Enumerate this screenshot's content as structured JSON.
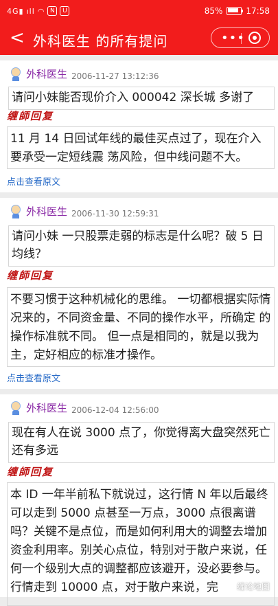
{
  "status_bar": {
    "left_icons": [
      "signal-4g-icon",
      "signal-icon",
      "wifi-icon",
      "app-n-icon",
      "app-u-icon"
    ],
    "battery": "85%",
    "time": "17:58"
  },
  "header": {
    "back_symbol": "<",
    "title": "外科医生  的所有提问"
  },
  "posts": [
    {
      "asker": "外科医生",
      "time": "2006-11-27 13:12:36",
      "question": "请问小妹能否现价介入 000042 深长城 多谢了",
      "reply_label": "缠師回复",
      "reply": "11 月 14 日回试年线的最佳买点过了，现在介入要承受一定短线震 荡风险，但中线问题不大。",
      "link": "点击查看原文"
    },
    {
      "asker": "外科医生",
      "time": "2006-11-30 12:59:31",
      "question": "请问小妹 一只股票走弱的标志是什么呢？破 5 日均线？",
      "reply_label": "缠師回复",
      "reply": "不要习惯于这种机械化的思维。 一切都根据实际情况来的，不同资金量、不同的操作水平，所确定 的操作标准就不同。 但一点是相同的，就是以我为主，定好相应的标准才操作。",
      "link": "点击查看原文"
    },
    {
      "asker": "外科医生",
      "time": "2006-12-04 12:56:00",
      "question": "现在有人在说 3000 点了，你觉得离大盘突然死亡还有多远",
      "reply_label": "缠師回复",
      "reply": "本 ID 一年半前私下就说过，这行情 N 年以后最终可以走到 5000 点甚至一万点，3000 点很离谱吗？关键不是点位，而是如何利用大的调整去增加资金利用率。别关心点位，特别对于散户来说，任何一个级别大点的调整都应该避开，没必要参与。行情走到 10000 点，对于散户来说，完"
    }
  ],
  "watermark": "缠论地图"
}
